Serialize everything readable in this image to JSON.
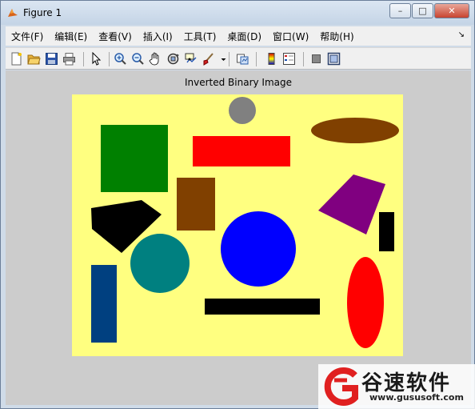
{
  "window": {
    "title": "Figure 1",
    "minimize": "–",
    "maximize": "□",
    "close": "✕"
  },
  "menu": [
    "文件(F)",
    "编辑(E)",
    "查看(V)",
    "插入(I)",
    "工具(T)",
    "桌面(D)",
    "窗口(W)",
    "帮助(H)"
  ],
  "menu_dock_icon": "dock-arrow-icon",
  "toolbar": [
    "new-figure-icon",
    "open-file-icon",
    "save-icon",
    "print-icon",
    "pointer-icon",
    "zoom-in-icon",
    "zoom-out-icon",
    "pan-hand-icon",
    "rotate-3d-icon",
    "data-cursor-icon",
    "brush-icon",
    "brush-dropdown-icon",
    "link-plot-icon",
    "colorbar-icon",
    "legend-icon",
    "hide-plot-tools-icon",
    "show-plot-tools-icon"
  ],
  "plot": {
    "title": "Inverted Binary Image",
    "background": "#ffff80",
    "shapes": [
      {
        "name": "gray-circle",
        "color": "#808080"
      },
      {
        "name": "brown-ellipse",
        "color": "#804000"
      },
      {
        "name": "green-square",
        "color": "#008000"
      },
      {
        "name": "red-rectangle",
        "color": "#ff0000"
      },
      {
        "name": "brown-rectangle",
        "color": "#804000"
      },
      {
        "name": "black-pentagon",
        "color": "#000000"
      },
      {
        "name": "purple-quad",
        "color": "#800080"
      },
      {
        "name": "black-small-rect",
        "color": "#000000"
      },
      {
        "name": "teal-circle",
        "color": "#008080"
      },
      {
        "name": "blue-circle",
        "color": "#0000ff"
      },
      {
        "name": "navy-bar",
        "color": "#004080"
      },
      {
        "name": "black-bar",
        "color": "#000000"
      },
      {
        "name": "red-ellipse",
        "color": "#ff0000"
      }
    ]
  },
  "watermark": {
    "name": "谷速软件",
    "url": "www.gususoft.com",
    "color": "#e02020"
  }
}
